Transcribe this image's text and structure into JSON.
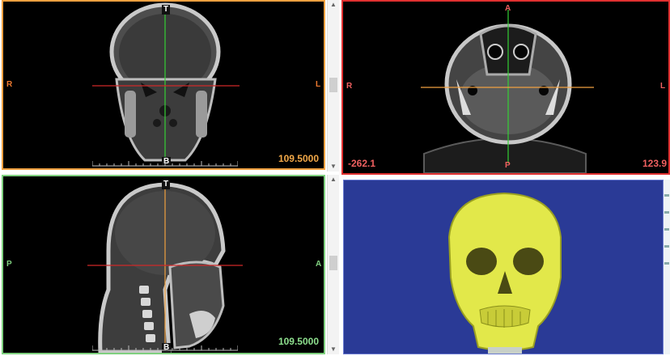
{
  "coronal": {
    "top_marker": "T",
    "bottom_marker": "B",
    "left_marker": "R",
    "right_marker": "L",
    "slice_value": "109.5000",
    "accent": "#f0a040"
  },
  "axial": {
    "top_marker": "A",
    "bottom_marker": "P",
    "left_marker": "R",
    "right_marker": "L",
    "coord_left": "-262.1",
    "coord_right": "123.9",
    "accent": "#e03030"
  },
  "sagittal": {
    "top_marker": "T",
    "bottom_marker": "B",
    "left_marker": "P",
    "right_marker": "A",
    "slice_value": "109.5000",
    "accent": "#7fd07f"
  },
  "render3d": {
    "background": "#2a3a96",
    "model_color": "#e2e84a"
  },
  "scrollbar": {
    "up": "▲",
    "down": "▼"
  }
}
